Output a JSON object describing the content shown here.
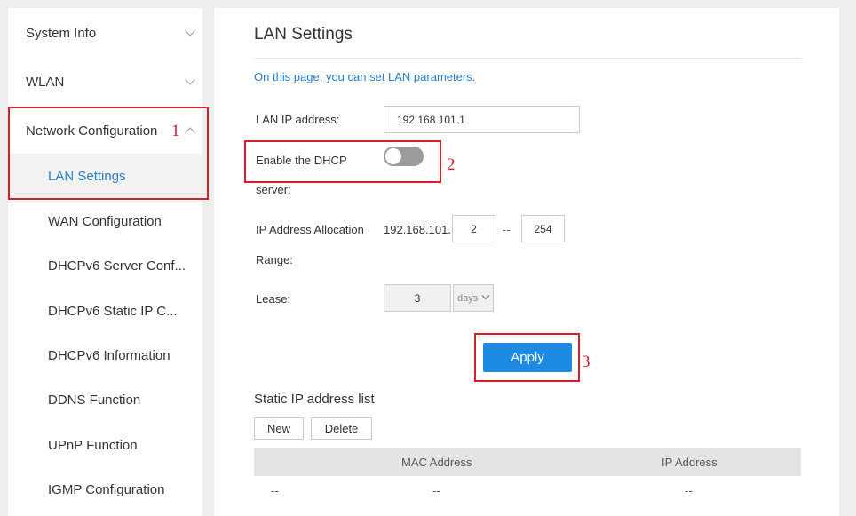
{
  "sidebar": {
    "items": [
      {
        "label": "System Info"
      },
      {
        "label": "WLAN"
      },
      {
        "label": "Network Configuration"
      }
    ],
    "subitems": [
      {
        "label": "LAN Settings"
      },
      {
        "label": "WAN Configuration"
      },
      {
        "label": "DHCPv6 Server Conf..."
      },
      {
        "label": "DHCPv6 Static IP C..."
      },
      {
        "label": "DHCPv6 Information"
      },
      {
        "label": "DDNS Function"
      },
      {
        "label": "UPnP Function"
      },
      {
        "label": "IGMP Configuration"
      }
    ]
  },
  "annotations": [
    "1",
    "2",
    "3"
  ],
  "main": {
    "title": "LAN Settings",
    "intro": "On this page, you can set LAN parameters.",
    "lan_ip": {
      "label": "LAN IP address:",
      "value": "192.168.101.1"
    },
    "dhcp": {
      "label_line1": "Enable the DHCP",
      "label_line2": "server:",
      "enabled": false
    },
    "range": {
      "label_line1": "IP Address Allocation",
      "label_line2": "Range:",
      "prefix": "192.168.101.",
      "start": "2",
      "separator": "--",
      "end": "254"
    },
    "lease": {
      "label": "Lease:",
      "value": "3",
      "unit": "days"
    },
    "apply_label": "Apply",
    "static_list": {
      "title": "Static IP address list",
      "new_label": "New",
      "delete_label": "Delete",
      "columns": [
        "MAC Address",
        "IP Address"
      ],
      "rows": [
        [
          "--",
          "--",
          "--"
        ]
      ]
    }
  },
  "colors": {
    "accent": "#1d8ae3",
    "link": "#2a7ec6",
    "annotation": "#d4202a",
    "toggle_off": "#9b9b9b"
  }
}
